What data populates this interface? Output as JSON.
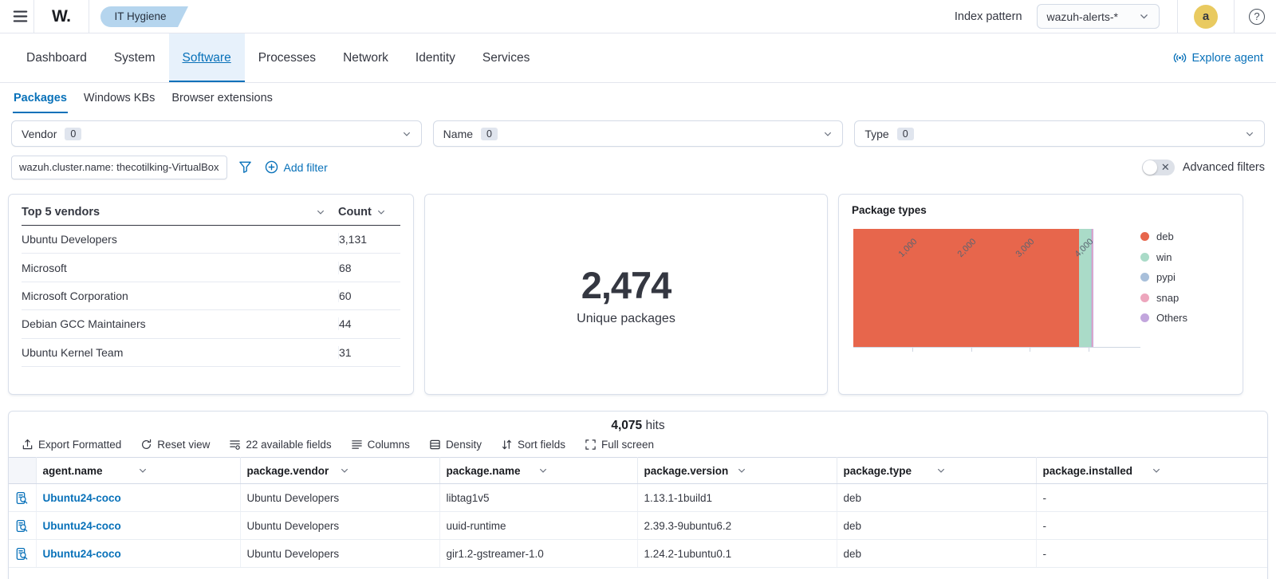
{
  "header": {
    "logo_text": "W.",
    "breadcrumb": "IT Hygiene",
    "index_pattern_label": "Index pattern",
    "index_pattern_value": "wazuh-alerts-*",
    "avatar_initial": "a"
  },
  "nav": {
    "tabs": [
      {
        "label": "Dashboard",
        "active": false
      },
      {
        "label": "System",
        "active": false
      },
      {
        "label": "Software",
        "active": true
      },
      {
        "label": "Processes",
        "active": false
      },
      {
        "label": "Network",
        "active": false
      },
      {
        "label": "Identity",
        "active": false
      },
      {
        "label": "Services",
        "active": false
      }
    ],
    "explore_agent_label": "Explore agent"
  },
  "subnav": {
    "tabs": [
      {
        "label": "Packages",
        "active": true
      },
      {
        "label": "Windows KBs",
        "active": false
      },
      {
        "label": "Browser extensions",
        "active": false
      }
    ]
  },
  "filters": {
    "selects": [
      {
        "label": "Vendor",
        "count": "0"
      },
      {
        "label": "Name",
        "count": "0"
      },
      {
        "label": "Type",
        "count": "0"
      }
    ],
    "pill_text": "wazuh.cluster.name: thecotilking-VirtualBox",
    "add_filter_label": "Add filter",
    "advanced_filters_label": "Advanced filters"
  },
  "top_vendors": {
    "title": "Top 5 vendors",
    "count_header": "Count",
    "rows": [
      {
        "vendor": "Ubuntu Developers",
        "count": "3,131"
      },
      {
        "vendor": "Microsoft",
        "count": "68"
      },
      {
        "vendor": "Microsoft Corporation",
        "count": "60"
      },
      {
        "vendor": "Debian GCC Maintainers",
        "count": "44"
      },
      {
        "vendor": "Ubuntu Kernel Team",
        "count": "31"
      }
    ]
  },
  "unique_packages": {
    "value": "2,474",
    "label": "Unique packages"
  },
  "chart_data": {
    "type": "bar",
    "orientation": "horizontal",
    "stacked": true,
    "title": "Package types",
    "series": [
      {
        "name": "deb",
        "value": 3840,
        "color": "#e7664c"
      },
      {
        "name": "win",
        "value": 205,
        "color": "#aadbc8"
      },
      {
        "name": "pypi",
        "value": 8,
        "color": "#a8bfda"
      },
      {
        "name": "snap",
        "value": 20,
        "color": "#eda6bd"
      },
      {
        "name": "Others",
        "value": 2,
        "color": "#c2a6dd"
      }
    ],
    "xlim": [
      0,
      4500
    ],
    "xticks": [
      {
        "value": 1000,
        "label": "1,000"
      },
      {
        "value": 2000,
        "label": "2,000"
      },
      {
        "value": 3000,
        "label": "3,000"
      },
      {
        "value": 4000,
        "label": "4,000"
      }
    ],
    "legend_position": "right",
    "grid": false
  },
  "results": {
    "hits_value": "4,075",
    "hits_label": "hits",
    "toolbar": [
      {
        "icon": "export-icon",
        "label": "Export Formatted"
      },
      {
        "icon": "refresh-icon",
        "label": "Reset view"
      },
      {
        "icon": "fields-icon",
        "label": "22 available fields"
      },
      {
        "icon": "columns-icon",
        "label": "Columns"
      },
      {
        "icon": "density-icon",
        "label": "Density"
      },
      {
        "icon": "sort-icon",
        "label": "Sort fields"
      },
      {
        "icon": "fullscreen-icon",
        "label": "Full screen"
      }
    ],
    "columns": [
      "agent.name",
      "package.vendor",
      "package.name",
      "package.version",
      "package.type",
      "package.installed"
    ],
    "rows": [
      {
        "agent_name": "Ubuntu24-coco",
        "package_vendor": "Ubuntu Developers",
        "package_name": "libtag1v5",
        "package_version": "1.13.1-1build1",
        "package_type": "deb",
        "package_installed": "-"
      },
      {
        "agent_name": "Ubuntu24-coco",
        "package_vendor": "Ubuntu Developers",
        "package_name": "uuid-runtime",
        "package_version": "2.39.3-9ubuntu6.2",
        "package_type": "deb",
        "package_installed": "-"
      },
      {
        "agent_name": "Ubuntu24-coco",
        "package_vendor": "Ubuntu Developers",
        "package_name": "gir1.2-gstreamer-1.0",
        "package_version": "1.24.2-1ubuntu0.1",
        "package_type": "deb",
        "package_installed": "-"
      }
    ]
  },
  "colors": {
    "accent_blue": "#0871b9",
    "text_dark": "#343741",
    "border": "#d3dae6",
    "breadcrumb_bg": "#b5d5ee",
    "avatar_bg": "#e9ca60",
    "active_tab_bg": "#e7f1fb"
  }
}
